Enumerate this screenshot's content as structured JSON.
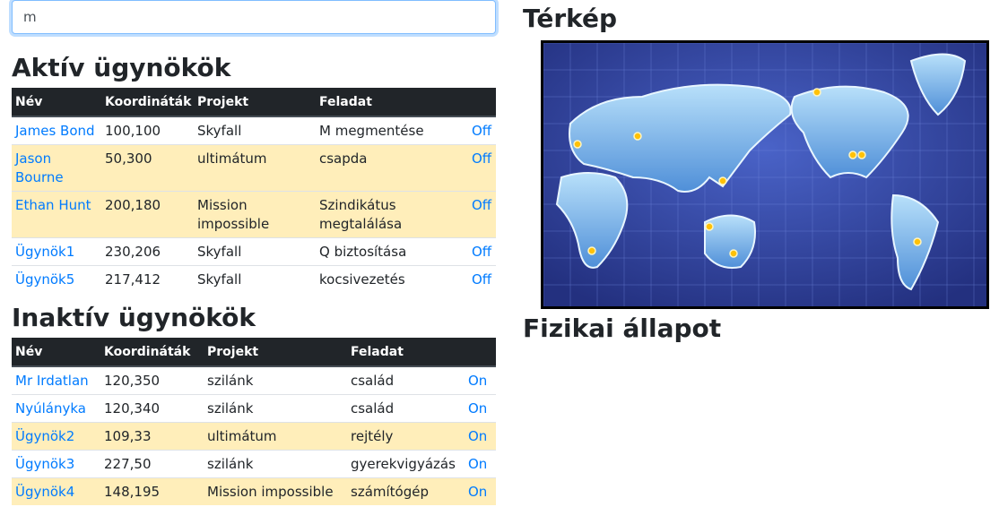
{
  "search": {
    "value": "m"
  },
  "active": {
    "title": "Aktív ügynökök",
    "headers": [
      "Név",
      "Koordináták",
      "Projekt",
      "Feladat",
      ""
    ],
    "rows": [
      {
        "name": "James Bond",
        "coords": "100,100",
        "project": "Skyfall",
        "task": "M megmentése",
        "status": "Off",
        "highlight": false
      },
      {
        "name": "Jason Bourne",
        "coords": "50,300",
        "project": "ultimátum",
        "task": "csapda",
        "status": "Off",
        "highlight": true
      },
      {
        "name": "Ethan Hunt",
        "coords": "200,180",
        "project": "Mission impossible",
        "task": "Szindikátus megtalálása",
        "status": "Off",
        "highlight": true
      },
      {
        "name": "Ügynök1",
        "coords": "230,206",
        "project": "Skyfall",
        "task": "Q biztosítása",
        "status": "Off",
        "highlight": false
      },
      {
        "name": "Ügynök5",
        "coords": "217,412",
        "project": "Skyfall",
        "task": "kocsivezetés",
        "status": "Off",
        "highlight": false
      }
    ]
  },
  "inactive": {
    "title": "Inaktív ügynökök",
    "headers": [
      "Név",
      "Koordináták",
      "Projekt",
      "Feladat",
      ""
    ],
    "rows": [
      {
        "name": "Mr Irdatlan",
        "coords": "120,350",
        "project": "szilánk",
        "task": "család",
        "status": "On",
        "highlight": false
      },
      {
        "name": "Nyúlányka",
        "coords": "120,340",
        "project": "szilánk",
        "task": "család",
        "status": "On",
        "highlight": false
      },
      {
        "name": "Ügynök2",
        "coords": "109,33",
        "project": "ultimátum",
        "task": "rejtély",
        "status": "On",
        "highlight": true
      },
      {
        "name": "Ügynök3",
        "coords": "227,50",
        "project": "szilánk",
        "task": "gyerekvigyázás",
        "status": "On",
        "highlight": false
      },
      {
        "name": "Ügynök4",
        "coords": "148,195",
        "project": "Mission impossible",
        "task": "számítógép",
        "status": "On",
        "highlight": true
      }
    ]
  },
  "map": {
    "title": "Térkép",
    "marker_color": "#ffc107"
  },
  "physical": {
    "title": "Fizikai állapot"
  },
  "colors": {
    "link": "#007bff",
    "header_bg": "#212529",
    "highlight": "#ffeeba"
  }
}
